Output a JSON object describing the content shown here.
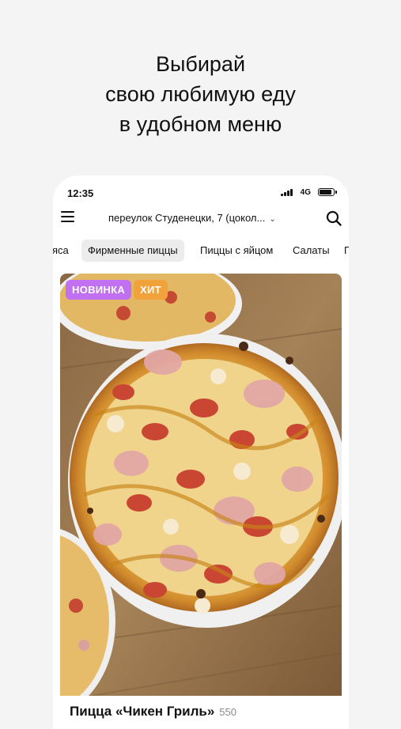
{
  "headline": {
    "lines": [
      "Выбирай",
      "свою любимую еду",
      "в удобном меню"
    ]
  },
  "status_bar": {
    "time": "12:35",
    "network": "4G"
  },
  "app_bar": {
    "address": "переулок Студенецки, 7 (цокол...",
    "menu_icon": "hamburger-menu-icon",
    "search_icon": "search-icon"
  },
  "categories": [
    {
      "label": "мяса",
      "active": false
    },
    {
      "label": "Фирменные пиццы",
      "active": true
    },
    {
      "label": "Пиццы с яйцом",
      "active": false
    },
    {
      "label": "Салаты",
      "active": false
    },
    {
      "label": "Г",
      "active": false
    }
  ],
  "product": {
    "badges": [
      {
        "label": "НОВИНКА",
        "color": "#c070f0"
      },
      {
        "label": "ХИТ",
        "color": "#f2a23a"
      }
    ],
    "title": "Пицца «Чикен Гриль»",
    "weight": "550"
  },
  "colors": {
    "background": "#f4f4f4",
    "phone": "#ffffff",
    "active_tab": "#ececec"
  }
}
